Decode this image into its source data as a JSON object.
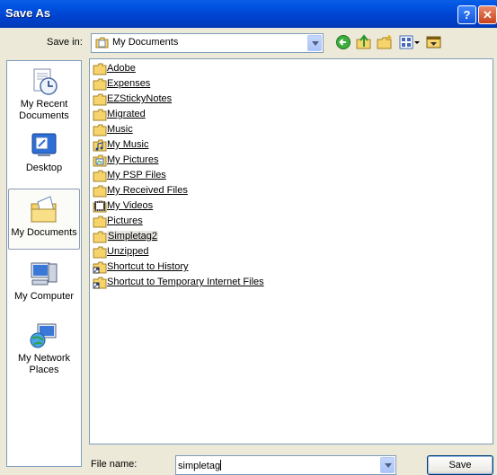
{
  "window": {
    "title": "Save As"
  },
  "titlebar": {
    "help_glyph": "?",
    "close_glyph": "✕"
  },
  "toolbar": {
    "save_in_label": "Save in:",
    "save_in_value": "My Documents",
    "icons": [
      "back-icon",
      "up-folder-icon",
      "new-folder-icon",
      "views-menu-icon",
      "tools-icon"
    ]
  },
  "places": [
    {
      "label": "My Recent Documents",
      "icon": "recent-documents-icon"
    },
    {
      "label": "Desktop",
      "icon": "desktop-icon"
    },
    {
      "label": "My Documents",
      "icon": "my-documents-icon",
      "selected": true
    },
    {
      "label": "My Computer",
      "icon": "my-computer-icon"
    },
    {
      "label": "My Network Places",
      "icon": "network-places-icon"
    }
  ],
  "files": [
    {
      "name": "Adobe",
      "type": "folder"
    },
    {
      "name": "Expenses",
      "type": "folder"
    },
    {
      "name": "EZStickyNotes",
      "type": "folder"
    },
    {
      "name": "Migrated",
      "type": "folder"
    },
    {
      "name": "Music",
      "type": "folder"
    },
    {
      "name": "My Music",
      "type": "music-folder"
    },
    {
      "name": "My Pictures",
      "type": "pictures-folder"
    },
    {
      "name": "My PSP Files",
      "type": "folder"
    },
    {
      "name": "My Received Files",
      "type": "folder"
    },
    {
      "name": "My Videos",
      "type": "videos-folder"
    },
    {
      "name": "Pictures",
      "type": "folder"
    },
    {
      "name": "Simpletag2",
      "type": "folder",
      "hover": true
    },
    {
      "name": "Unzipped",
      "type": "folder"
    },
    {
      "name": "Shortcut to History",
      "type": "shortcut"
    },
    {
      "name": "Shortcut to Temporary Internet Files",
      "type": "shortcut"
    }
  ],
  "footer": {
    "file_name_label": "File name:",
    "file_name_value": "simpletag",
    "save_label": "Save"
  },
  "colors": {
    "title_bar": "#0054e3",
    "face": "#ece9d8",
    "border": "#7f9db9",
    "folder": "#f6d36b"
  }
}
